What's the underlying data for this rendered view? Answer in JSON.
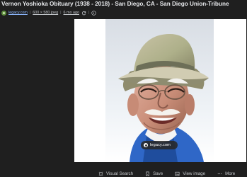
{
  "result": {
    "title": "Vernon Yoshioka Obituary (1938 - 2018) - San Diego, CA - San Diego Union-Tribune",
    "source": "legacy.com",
    "dimensions": "600 × 580 jpeg",
    "age": "6 mo ago",
    "favicon_icon": "legacy-favicon-icon",
    "feedback_icon": "refresh-icon",
    "info_icon": "info-icon"
  },
  "image": {
    "watermark_text": "legacy.com",
    "watermark_icon": "legacy-logo-icon"
  },
  "actions": [
    {
      "label": "Visual Search",
      "icon": "lens-icon"
    },
    {
      "label": "Save",
      "icon": "bookmark-icon"
    },
    {
      "label": "View image",
      "icon": "image-icon"
    },
    {
      "label": "More",
      "icon": "more-dots-icon"
    }
  ],
  "colors": {
    "background": "#1f1f1f",
    "panel": "#ffffff",
    "link": "#8ab4f8"
  }
}
